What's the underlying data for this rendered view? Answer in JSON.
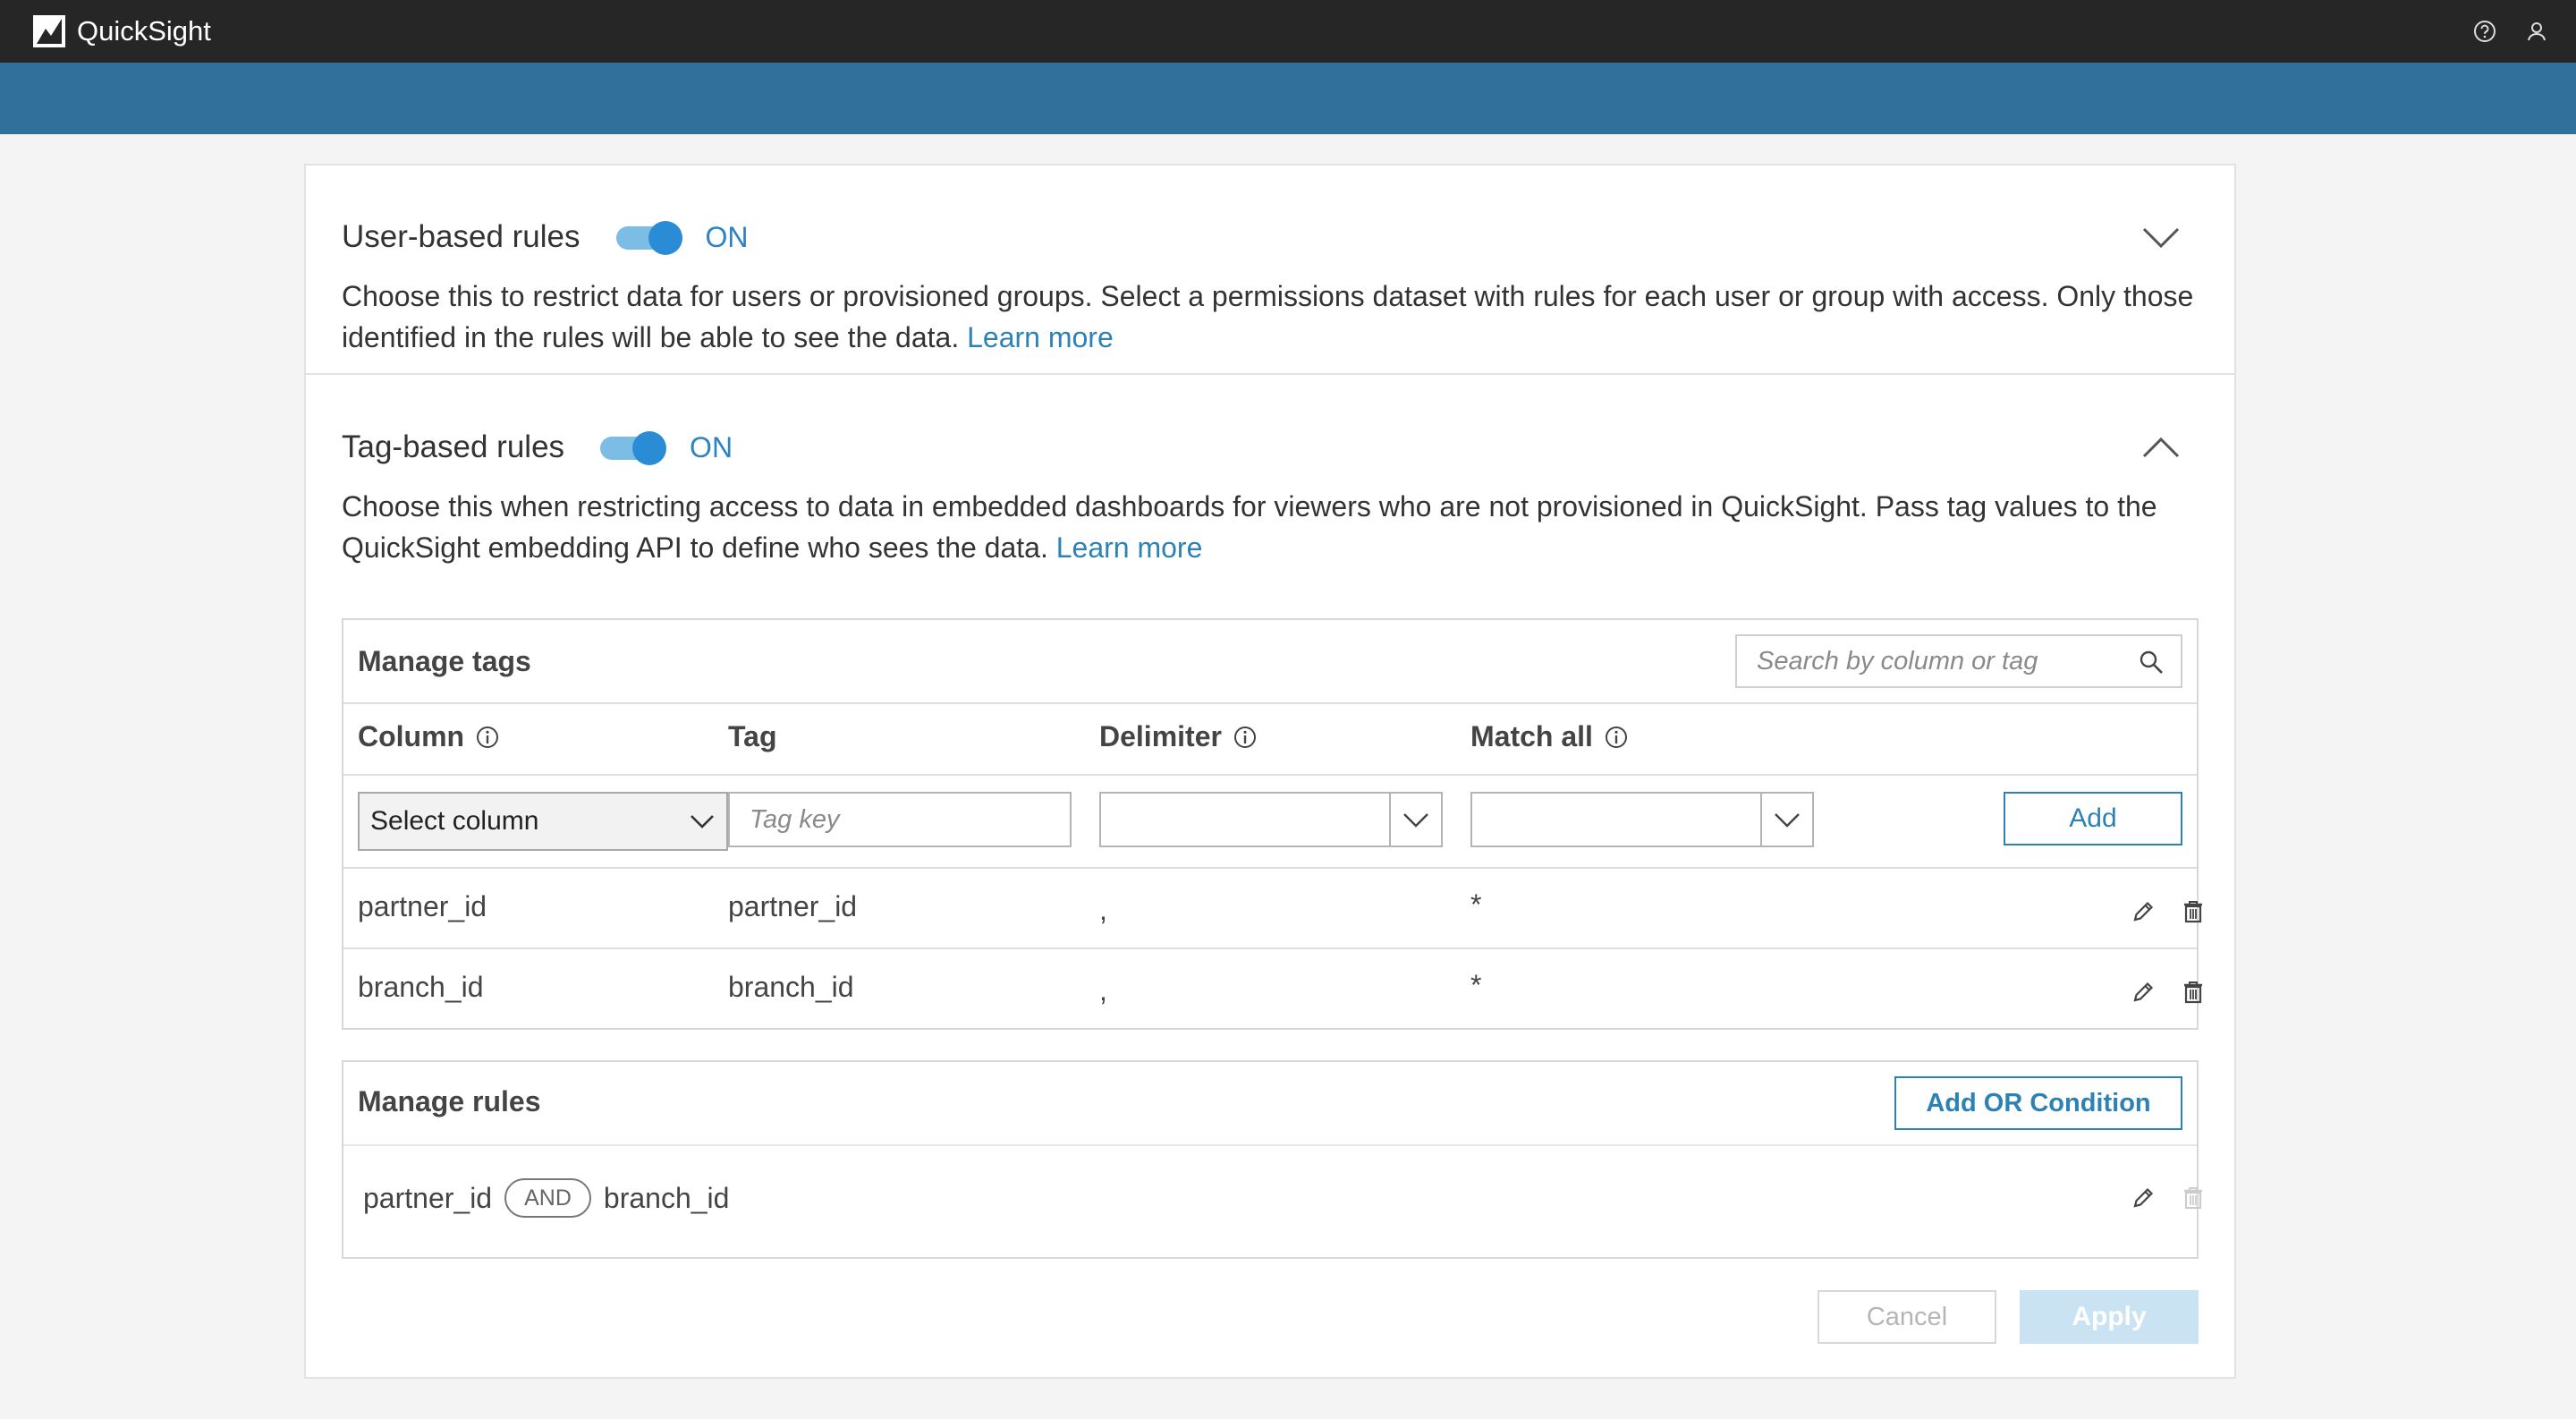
{
  "app": {
    "title": "QuickSight"
  },
  "topbar": {
    "help_icon": "help-circle-icon",
    "user_icon": "user-icon"
  },
  "user_rules": {
    "title": "User-based rules",
    "toggle_state": "ON",
    "description": "Choose this to restrict data for users or provisioned groups. Select a permissions dataset with rules for each user or group with access. Only those identified in the rules will be able to see the data.",
    "learn_more": "Learn more"
  },
  "tag_rules": {
    "title": "Tag-based rules",
    "toggle_state": "ON",
    "description": "Choose this when restricting access to data in embedded dashboards for viewers who are not provisioned in QuickSight. Pass tag values to the QuickSight embedding API to define who sees the data.",
    "learn_more": "Learn more"
  },
  "manage_tags": {
    "title": "Manage tags",
    "search_placeholder": "Search by column or tag",
    "columns": [
      "Column",
      "Tag",
      "Delimiter",
      "Match all"
    ],
    "new_row": {
      "column_select": "Select column",
      "tag_placeholder": "Tag key",
      "delimiter": "",
      "match_all": "",
      "add_label": "Add"
    },
    "rows": [
      {
        "column": "partner_id",
        "tag": "partner_id",
        "delimiter": ",",
        "match_all": "*"
      },
      {
        "column": "branch_id",
        "tag": "branch_id",
        "delimiter": ",",
        "match_all": "*"
      }
    ]
  },
  "manage_rules": {
    "title": "Manage rules",
    "add_or_label": "Add OR Condition",
    "rule": {
      "left": "partner_id",
      "operator": "AND",
      "right": "branch_id"
    }
  },
  "footer": {
    "cancel_label": "Cancel",
    "apply_label": "Apply"
  }
}
